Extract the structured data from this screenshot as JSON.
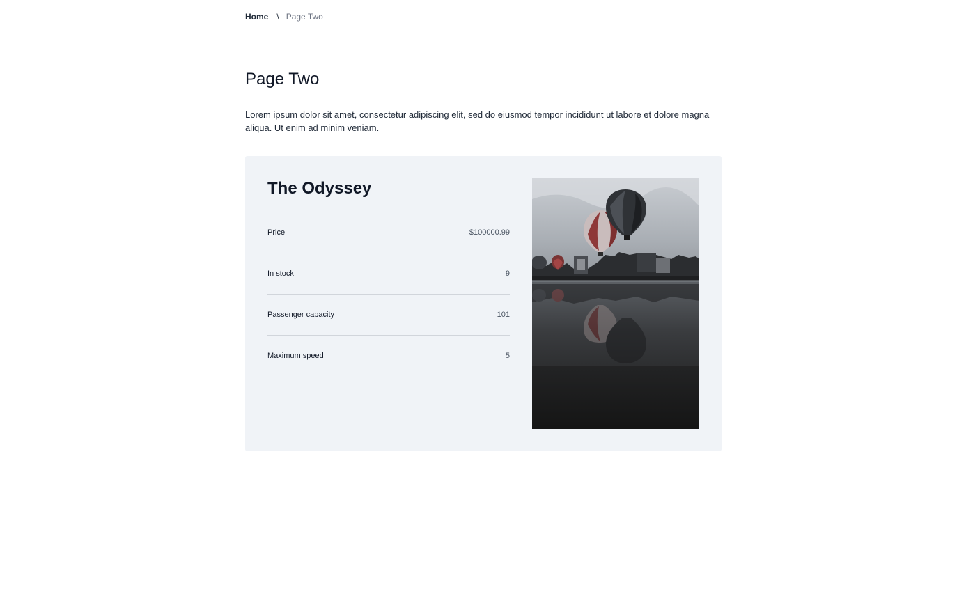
{
  "breadcrumb": {
    "home": "Home",
    "separator": "\\",
    "current": "Page Two"
  },
  "page": {
    "title": "Page Two",
    "intro": "Lorem ipsum dolor sit amet, consectetur adipiscing elit, sed do eiusmod tempor incididunt ut labore et dolore magna aliqua. Ut enim ad minim veniam."
  },
  "product": {
    "name": "The Odyssey",
    "specs": [
      {
        "label": "Price",
        "value": "$100000.99"
      },
      {
        "label": "In stock",
        "value": "9"
      },
      {
        "label": "Passenger capacity",
        "value": "101"
      },
      {
        "label": "Maximum speed",
        "value": "5"
      }
    ]
  },
  "colors": {
    "card_background": "#f0f3f7",
    "divider": "#d1d5db",
    "text_primary": "#111827",
    "text_muted": "#6b7280"
  }
}
